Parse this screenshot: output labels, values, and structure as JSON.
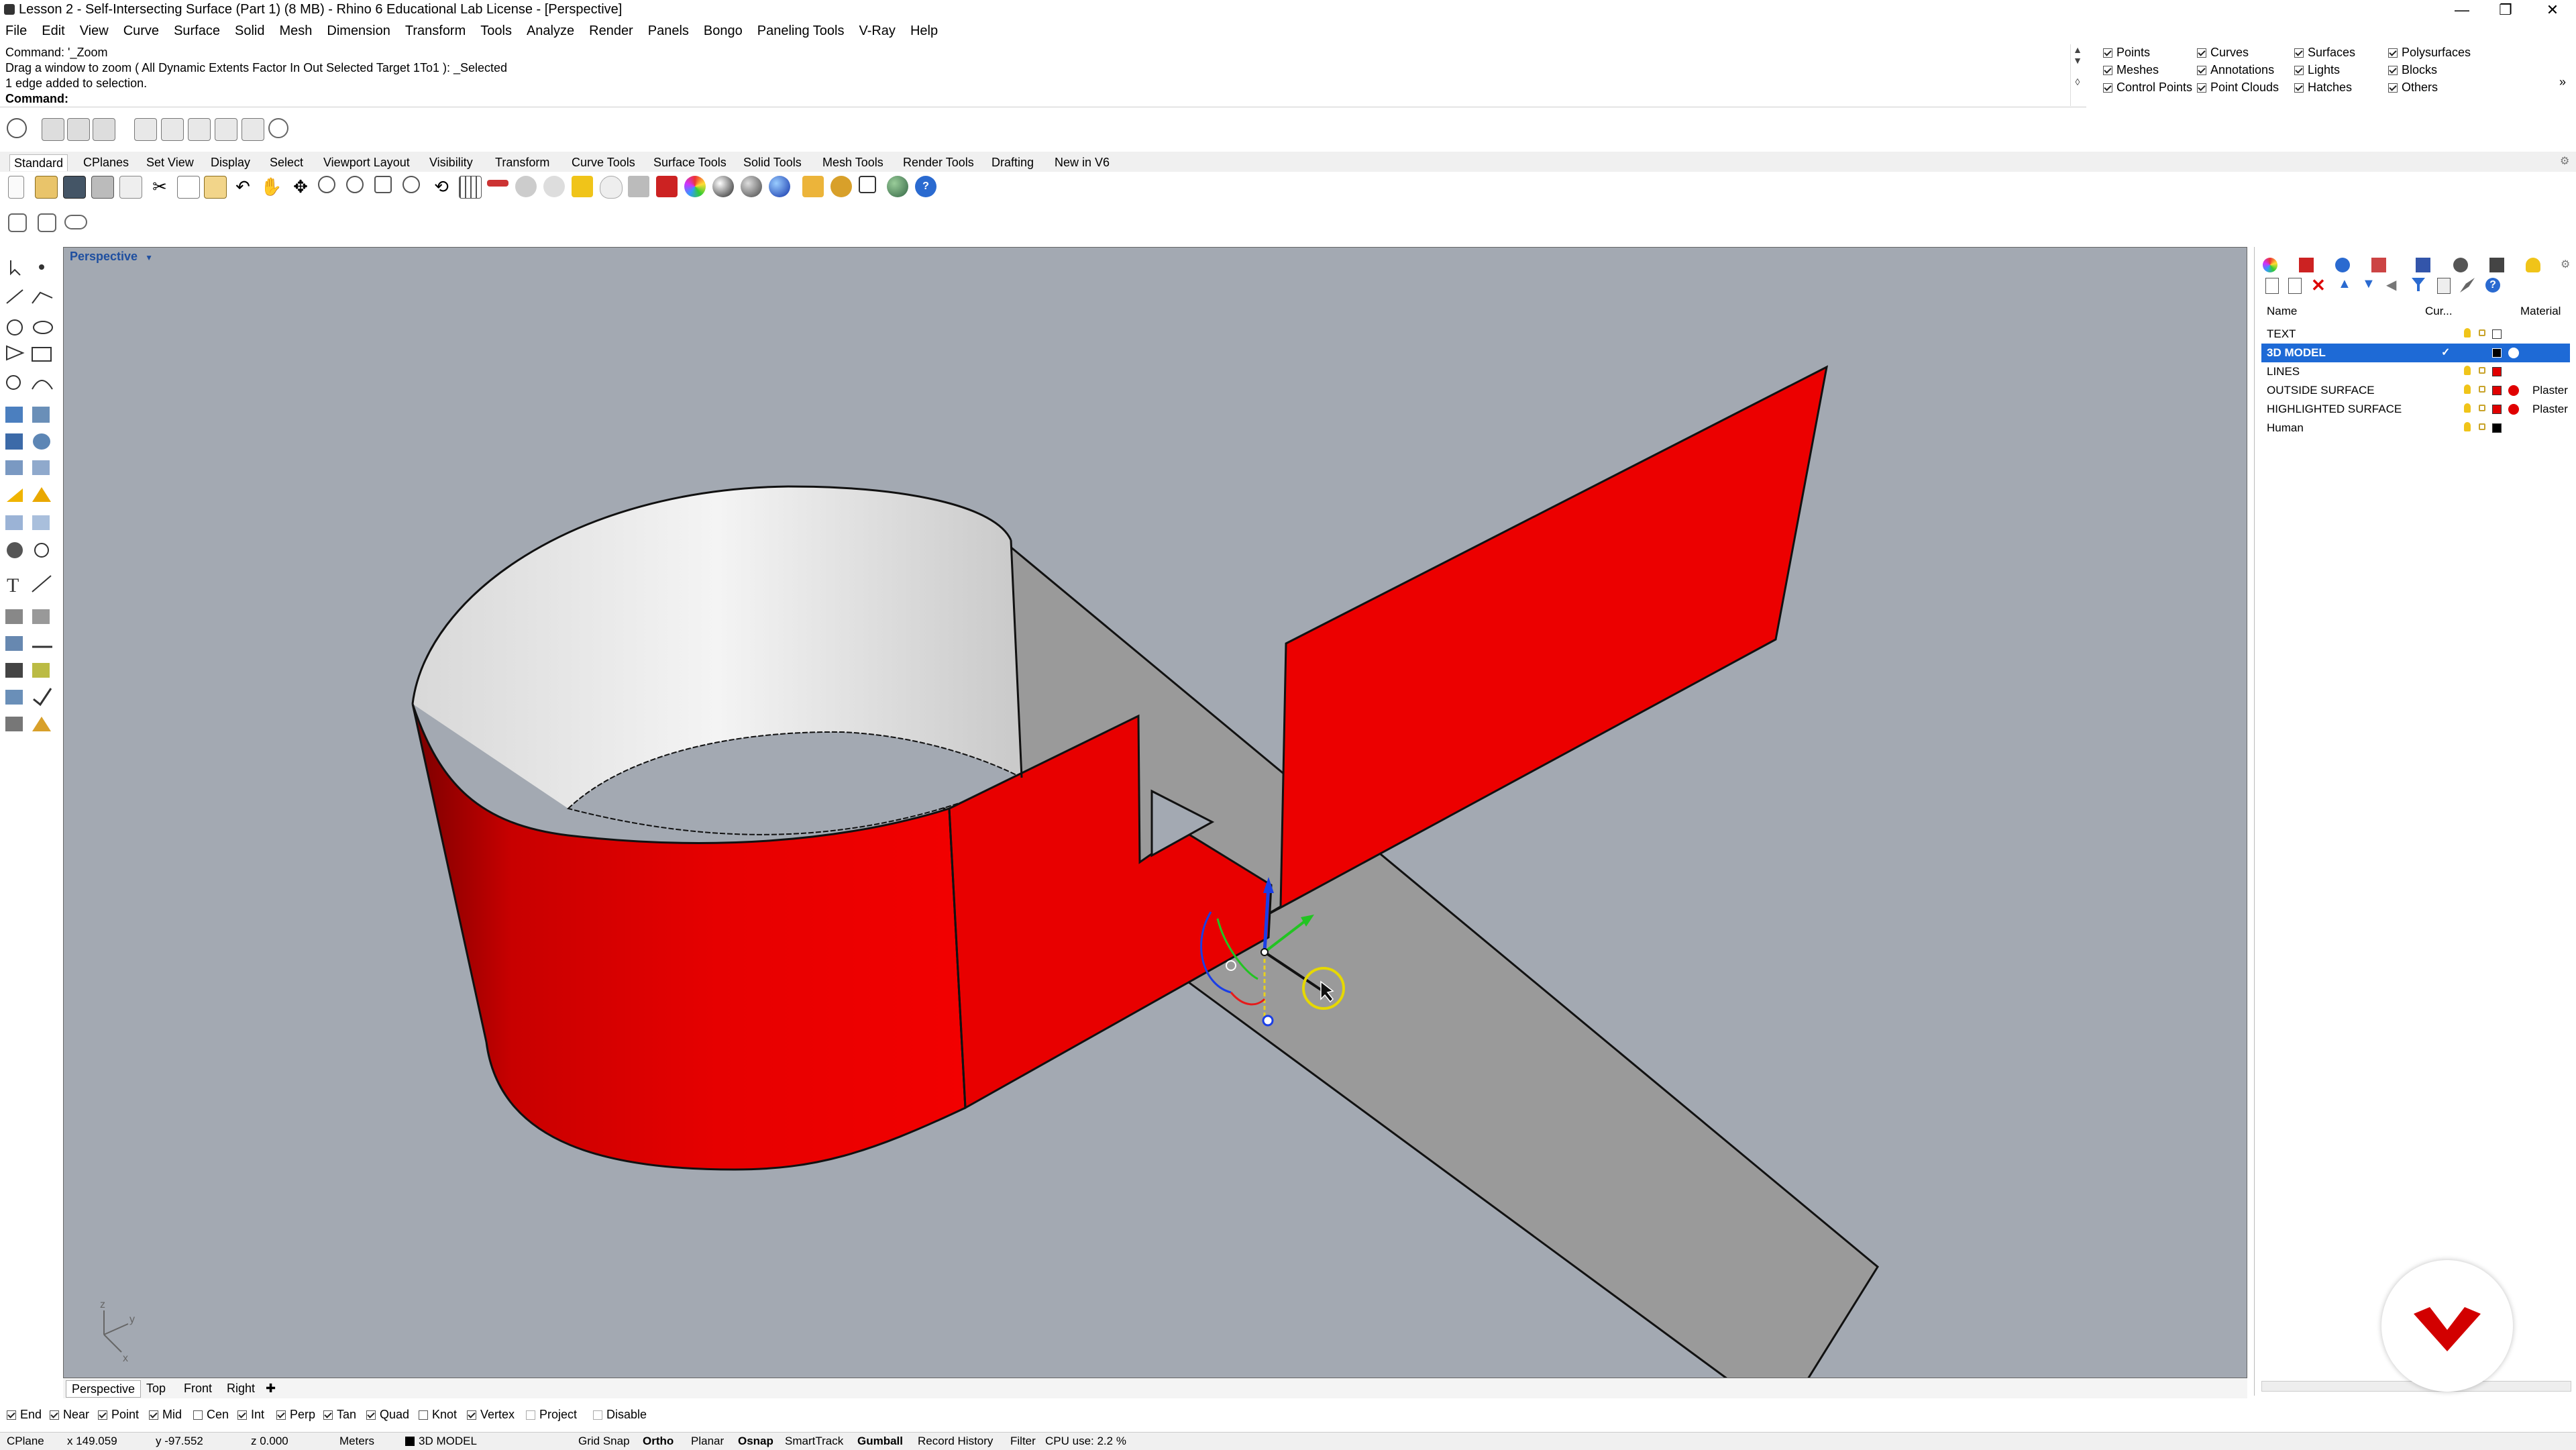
{
  "window": {
    "title": "Lesson 2 - Self-Intersecting Surface (Part 1) (8 MB) - Rhino 6 Educational Lab License - [Perspective]"
  },
  "menu": [
    "File",
    "Edit",
    "View",
    "Curve",
    "Surface",
    "Solid",
    "Mesh",
    "Dimension",
    "Transform",
    "Tools",
    "Analyze",
    "Render",
    "Panels",
    "Bongo",
    "Paneling Tools",
    "V-Ray",
    "Help"
  ],
  "command": {
    "line1": "Command: '_Zoom",
    "line2": "Drag a window to zoom ( All  Dynamic  Extents  Factor  In  Out  Selected  Target  1To1 ): _Selected",
    "line3": "1 edge added to selection.",
    "prompt": "Command:"
  },
  "filters": [
    {
      "label": "Points",
      "on": true
    },
    {
      "label": "Curves",
      "on": true
    },
    {
      "label": "Surfaces",
      "on": true
    },
    {
      "label": "Polysurfaces",
      "on": true
    },
    {
      "label": "Meshes",
      "on": true
    },
    {
      "label": "Annotations",
      "on": true
    },
    {
      "label": "Lights",
      "on": true
    },
    {
      "label": "Blocks",
      "on": true
    },
    {
      "label": "Control Points",
      "on": true
    },
    {
      "label": "Point Clouds",
      "on": true
    },
    {
      "label": "Hatches",
      "on": true
    },
    {
      "label": "Others",
      "on": true
    }
  ],
  "toolbar_tabs": [
    "Standard",
    "CPlanes",
    "Set View",
    "Display",
    "Select",
    "Viewport Layout",
    "Visibility",
    "Transform",
    "Curve Tools",
    "Surface Tools",
    "Solid Tools",
    "Mesh Tools",
    "Render Tools",
    "Drafting",
    "New in V6"
  ],
  "viewport": {
    "title": "Perspective",
    "tabs": [
      "Perspective",
      "Top",
      "Front",
      "Right"
    ],
    "background_color": "#a3a9b2",
    "model_color": "#e60000",
    "grey_surface_color": "#9a9a9a"
  },
  "layers": {
    "headers": {
      "name": "Name",
      "current": "Cur...",
      "material": "Material"
    },
    "rows": [
      {
        "name": "TEXT",
        "color": "#ffffff",
        "material": "",
        "selected": false
      },
      {
        "name": "3D MODEL",
        "color": "#000000",
        "material": "",
        "selected": true
      },
      {
        "name": "LINES",
        "color": "#e00000",
        "material": "",
        "selected": false
      },
      {
        "name": "OUTSIDE SURFACE",
        "color": "#e00000",
        "material": "Plaster",
        "selected": false
      },
      {
        "name": "HIGHLIGHTED SURFACE",
        "color": "#e00000",
        "material": "Plaster",
        "selected": false
      },
      {
        "name": "Human",
        "color": "#000000",
        "material": "",
        "selected": false
      }
    ]
  },
  "osnaps": [
    {
      "label": "End",
      "on": true
    },
    {
      "label": "Near",
      "on": true
    },
    {
      "label": "Point",
      "on": true
    },
    {
      "label": "Mid",
      "on": true
    },
    {
      "label": "Cen",
      "on": false
    },
    {
      "label": "Int",
      "on": true
    },
    {
      "label": "Perp",
      "on": true
    },
    {
      "label": "Tan",
      "on": true
    },
    {
      "label": "Quad",
      "on": true
    },
    {
      "label": "Knot",
      "on": false
    },
    {
      "label": "Vertex",
      "on": true
    },
    {
      "label": "Project",
      "on": false
    },
    {
      "label": "Disable",
      "on": false
    }
  ],
  "status": {
    "cplane": "CPlane",
    "x": "x 149.059",
    "y": "y -97.552",
    "z": "z 0.000",
    "units": "Meters",
    "layer": "3D MODEL",
    "grid_snap": "Grid Snap",
    "ortho": "Ortho",
    "planar": "Planar",
    "osnap": "Osnap",
    "smarttrack": "SmartTrack",
    "gumball": "Gumball",
    "record_history": "Record History",
    "filter": "Filter",
    "cpu": "CPU use: 2.2 %"
  }
}
